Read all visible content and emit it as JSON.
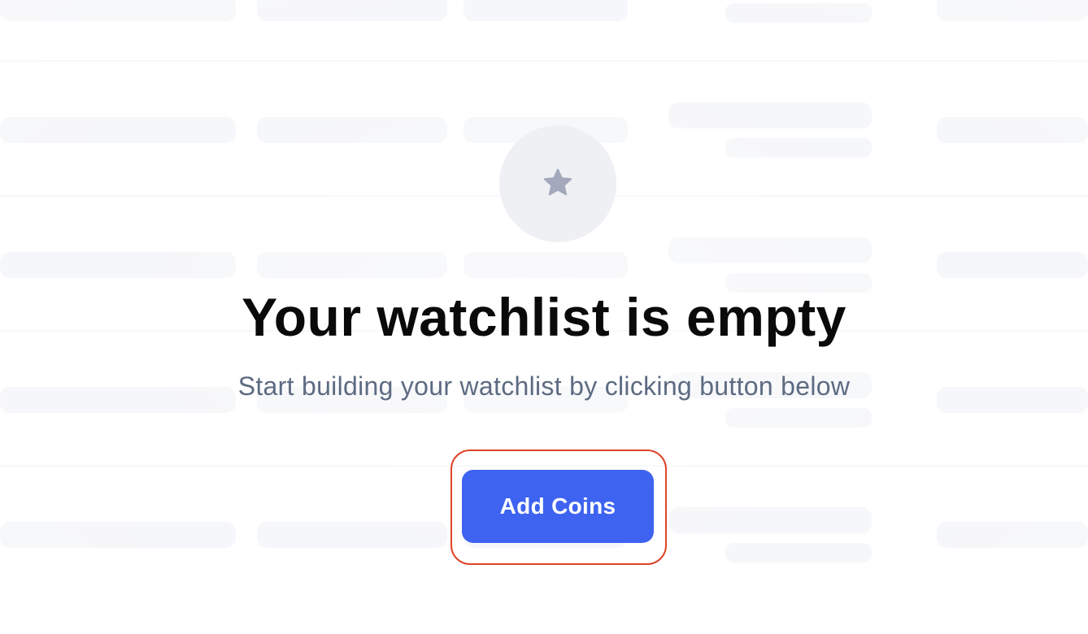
{
  "empty_state": {
    "icon": "star-icon",
    "title": "Your watchlist is empty",
    "subtitle": "Start building your watchlist by clicking button below",
    "button_label": "Add Coins"
  },
  "colors": {
    "primary_button": "#3e63f0",
    "title_text": "#0a0a0a",
    "subtitle_text": "#5d6b82",
    "icon_circle_bg": "#eef0f4",
    "icon_fill": "#a3a9bb",
    "highlight_outline": "#e0432a"
  }
}
